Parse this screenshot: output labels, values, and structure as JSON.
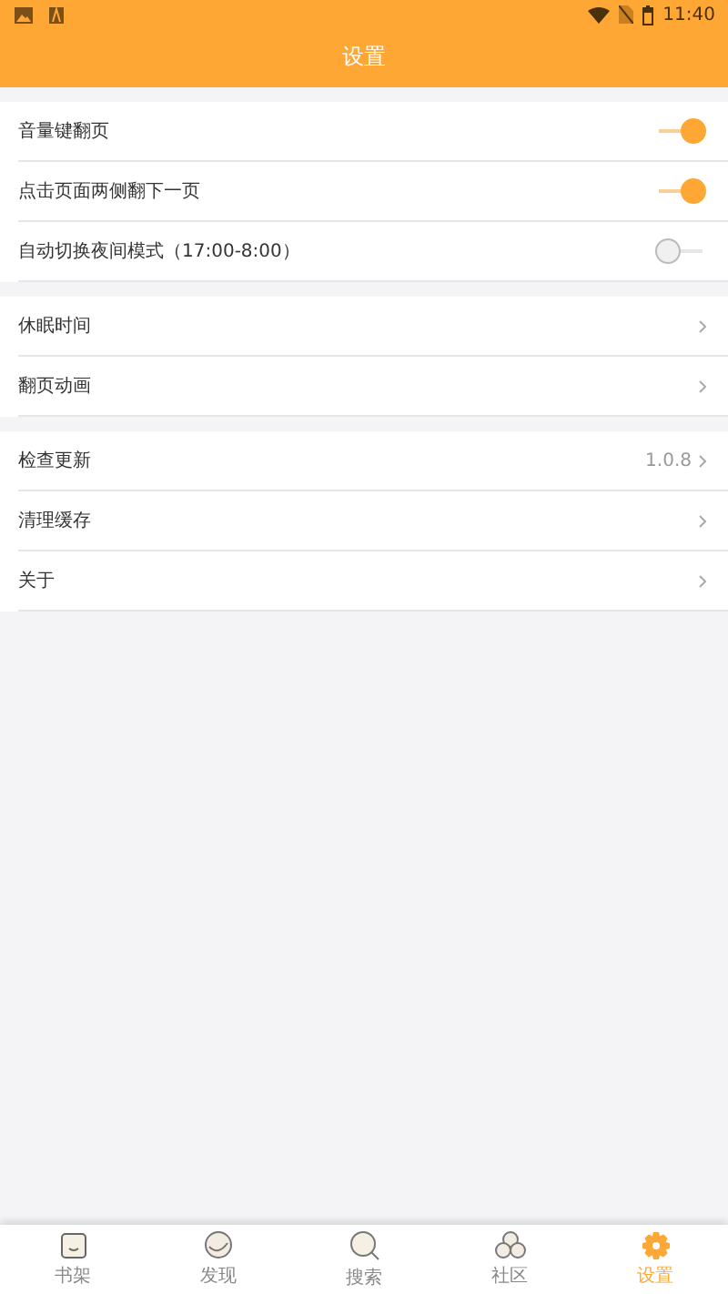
{
  "status_bar": {
    "time": "11:40"
  },
  "header": {
    "title": "设置"
  },
  "sections": [
    {
      "items": [
        {
          "kind": "toggle",
          "label": "音量键翻页",
          "on": true
        },
        {
          "kind": "toggle",
          "label": "点击页面两侧翻下一页",
          "on": true
        },
        {
          "kind": "toggle",
          "label": "自动切换夜间模式（17:00-8:00）",
          "on": false
        }
      ]
    },
    {
      "items": [
        {
          "kind": "link",
          "label": "休眠时间"
        },
        {
          "kind": "link",
          "label": "翻页动画"
        }
      ]
    },
    {
      "items": [
        {
          "kind": "link",
          "label": "检查更新",
          "value": "1.0.8"
        },
        {
          "kind": "link",
          "label": "清理缓存"
        },
        {
          "kind": "link",
          "label": "关于"
        }
      ]
    }
  ],
  "bottom_nav": [
    {
      "kind": "book",
      "label": "书架",
      "selected": false
    },
    {
      "kind": "face",
      "label": "发现",
      "selected": false
    },
    {
      "kind": "search",
      "label": "搜索",
      "selected": false
    },
    {
      "kind": "group",
      "label": "社区",
      "selected": false
    },
    {
      "kind": "gear",
      "label": "设置",
      "selected": true
    }
  ]
}
